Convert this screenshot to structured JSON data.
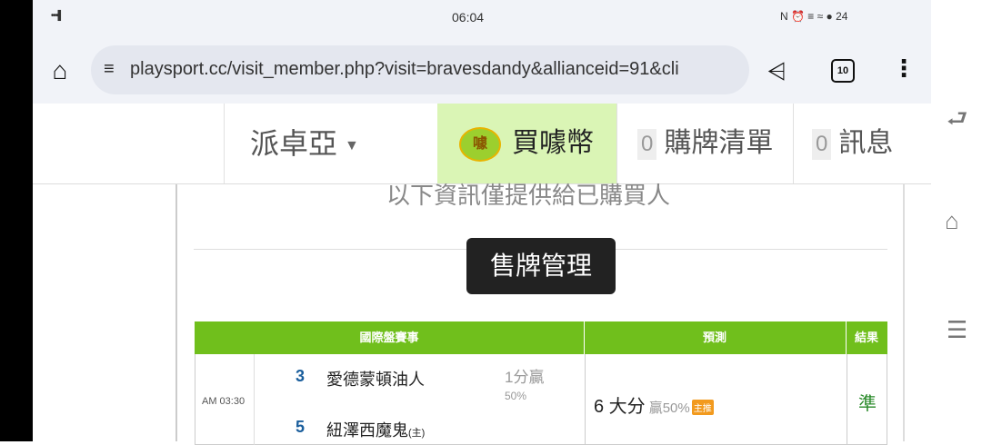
{
  "status_bar": {
    "time": "06:04",
    "signal": "•••▌",
    "right_icons": "N ⏰ ≡ ≈ ● 24"
  },
  "browser": {
    "url": "playsport.cc/visit_member.php?visit=bravesdandy&allianceid=91&cli",
    "tab_count": "10"
  },
  "navbar": {
    "user": "派卓亞",
    "coin_label": "買噱幣",
    "coin_icon_text": "噱",
    "cart_count": "0",
    "cart_label": "購牌清單",
    "msg_count": "0",
    "msg_label": "訊息"
  },
  "content": {
    "info_text": "以下資訊僅提供給已購買人",
    "sell_button": "售牌管理",
    "table": {
      "headers": [
        "國際盤賽事",
        "預測",
        "結果"
      ],
      "rows": [
        {
          "time": "AM 03:30",
          "away_num": "3",
          "away_name": "愛德蒙頓油人",
          "home_num": "5",
          "home_name": "紐澤西魔鬼",
          "home_tag": "(主)",
          "handicap": "1分贏",
          "handicap_pct": "50%",
          "prediction": "6 大分",
          "prediction_win": "贏50%",
          "prediction_tag": "主推",
          "result": "準"
        }
      ]
    }
  }
}
